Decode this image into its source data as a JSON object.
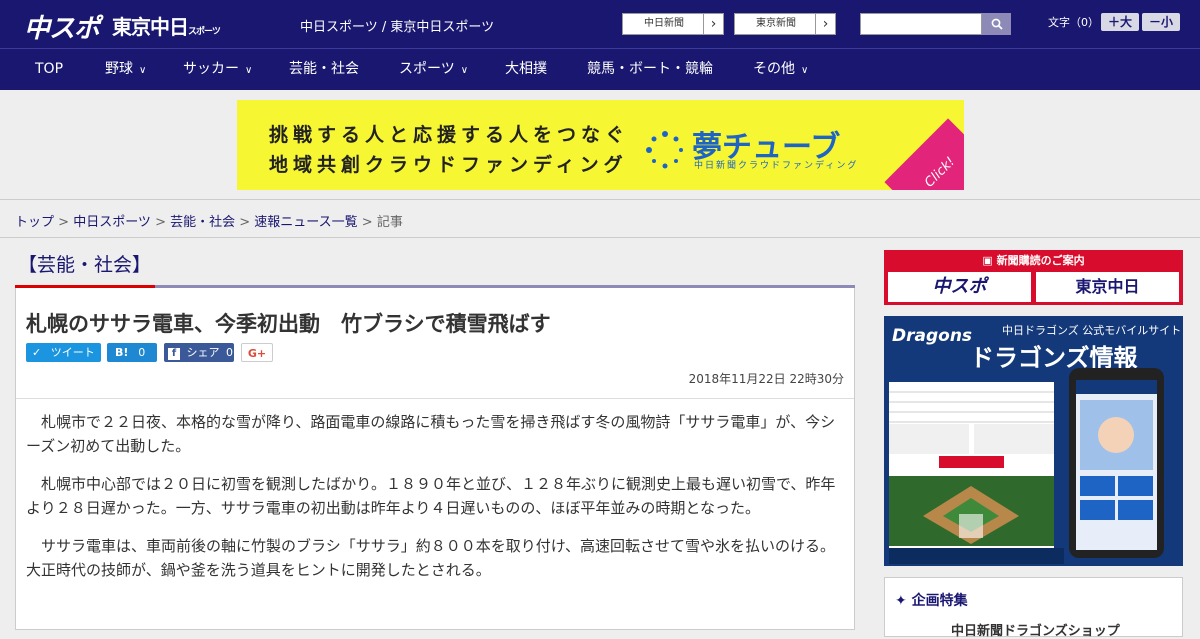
{
  "header": {
    "logo_chuspo": "中スポ",
    "logo_tokyo": "東京中日",
    "logo_tokyo_small": "スポーツ",
    "site_names": "中日スポーツ / 東京中日スポーツ",
    "link_chunichi": "中日新聞",
    "link_tokyo": "東京新聞",
    "search_placeholder": "",
    "font_label": "文字（0）",
    "font_large": "＋大",
    "font_small": "－小"
  },
  "nav": {
    "items": [
      {
        "label": "TOP"
      },
      {
        "label": "野球"
      },
      {
        "label": "サッカー"
      },
      {
        "label": "芸能・社会"
      },
      {
        "label": "スポーツ"
      },
      {
        "label": "大相撲"
      },
      {
        "label": "競馬・ボート・競輪"
      },
      {
        "label": "その他"
      }
    ]
  },
  "banner": {
    "line1": "挑戦する人と応援する人をつなぐ",
    "line2": "地域共創クラウドファンディング",
    "brand": "夢チューブ",
    "brand_sub": "中日新聞クラウドファンディング",
    "click": "Click!"
  },
  "breadcrumb": {
    "top": "トップ",
    "chunichi": "中日スポーツ",
    "category": "芸能・社会",
    "news": "速報ニュース一覧",
    "current": "記事",
    "sep": " > "
  },
  "section": {
    "title": "【芸能・社会】"
  },
  "article": {
    "headline": "札幌のササラ電車、今季初出動　竹ブラシで積雪飛ばす",
    "share_tweet": "ツイート",
    "share_hatena": "B!",
    "share_hatena_count": "0",
    "share_fb": "シェア",
    "share_fb_count": "0",
    "share_gplus": "G+",
    "date": "2018年11月22日 22時30分",
    "paragraphs": [
      "札幌市で２２日夜、本格的な雪が降り、路面電車の線路に積もった雪を掃き飛ばす冬の風物詩「ササラ電車」が、今シーズン初めて出動した。",
      "札幌市中心部では２０日に初雪を観測したばかり。１８９０年と並び、１２８年ぶりに観測史上最も遅い初雪で、昨年より２８日遅かった。一方、ササラ電車の初出動は昨年より４日遅いものの、ほぼ平年並みの時期となった。",
      "ササラ電車は、車両前後の軸に竹製のブラシ「ササラ」約８００本を取り付け、高速回転させて雪や氷を払いのける。大正時代の技師が、鍋や釜を洗う道具をヒントに開発したとされる。"
    ]
  },
  "sidebar": {
    "subscribe_heading": "新聞購読のご案内",
    "subscribe_chuspo": "中スポ",
    "subscribe_tokyo": "東京中日",
    "dragons_logo": "Dragons",
    "dragons_sub": "中日ドラゴンズ 公式モバイルサイト",
    "dragons_title": "ドラゴンズ情報",
    "project_heading": "企画特集",
    "project_item": "中日新聞ドラゴンズショップ"
  },
  "colors": {
    "brand_navy": "#1a1770",
    "accent_red": "#d80d2d",
    "banner_yellow": "#f6f633"
  }
}
